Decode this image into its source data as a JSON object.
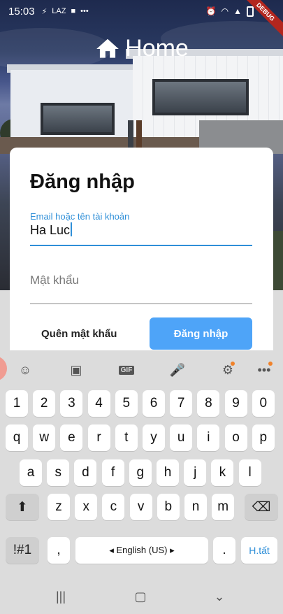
{
  "status_bar": {
    "time": "15:03",
    "left_icons": [
      "⚡",
      "LAZ"
    ],
    "right_icons": [
      "alarm-icon",
      "wifi-icon",
      "signal-icon",
      "battery-icon"
    ],
    "debug_banner": "DEBUG"
  },
  "header": {
    "title": "Home",
    "icon": "home-icon"
  },
  "login": {
    "heading": "Đăng nhập",
    "email_label": "Email hoặc tên tài khoản",
    "email_value": "Ha Luc",
    "password_placeholder": "Mật khẩu",
    "forgot_label": "Quên mật khẩu",
    "submit_label": "Đăng nhập",
    "accent_color": "#2f8fd8",
    "button_color": "#4ea4f8"
  },
  "keyboard": {
    "toolbar_icons": [
      "emoji-icon",
      "sticker-icon",
      "gif-icon",
      "mic-icon",
      "settings-icon",
      "more-icon"
    ],
    "gif_label": "GIF",
    "row1": [
      "1",
      "2",
      "3",
      "4",
      "5",
      "6",
      "7",
      "8",
      "9",
      "0"
    ],
    "row2": [
      "q",
      "w",
      "e",
      "r",
      "t",
      "y",
      "u",
      "i",
      "o",
      "p"
    ],
    "row3": [
      "a",
      "s",
      "d",
      "f",
      "g",
      "h",
      "j",
      "k",
      "l"
    ],
    "row4": [
      "z",
      "x",
      "c",
      "v",
      "b",
      "n",
      "m"
    ],
    "symbols_label": "!#1",
    "comma_label": ",",
    "space_label": "◂ English (US) ▸",
    "period_label": ".",
    "done_label": "H.tất"
  },
  "nav_bar": {
    "icons": [
      "recents-icon",
      "home-nav-icon",
      "back-icon"
    ]
  }
}
